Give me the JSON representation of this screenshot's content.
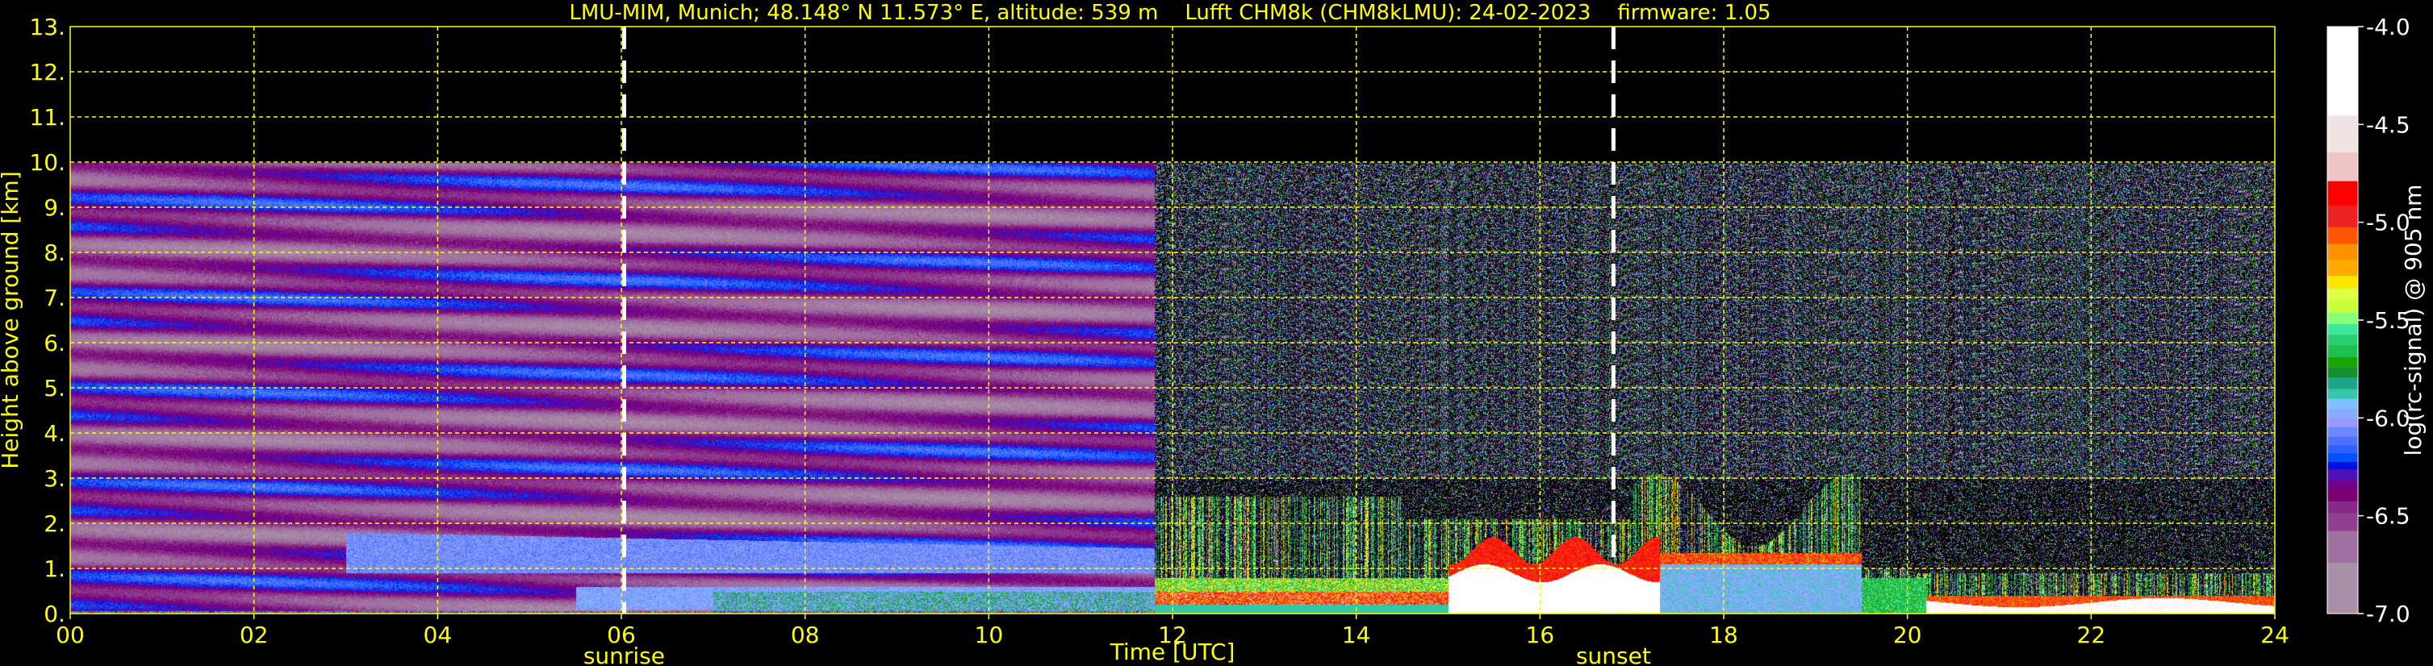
{
  "chart_data": {
    "type": "heatmap",
    "title": "LMU-MIM, Munich; 48.148° N 11.573° E, altitude: 539 m    Lufft CHM8k (CHM8kLMU): 24-02-2023    firmware: 1.05",
    "xlabel": "Time [UTC]",
    "ylabel": "Height above ground [km]",
    "xlim": [
      0,
      24
    ],
    "ylim": [
      0,
      13
    ],
    "grid": true,
    "x_ticks": [
      0,
      2,
      4,
      6,
      8,
      10,
      12,
      14,
      16,
      18,
      20,
      22,
      24
    ],
    "x_tick_labels": [
      "00",
      "02",
      "04",
      "06",
      "08",
      "10",
      "12",
      "14",
      "16",
      "18",
      "20",
      "22",
      "24"
    ],
    "y_ticks": [
      0,
      1,
      2,
      3,
      4,
      5,
      6,
      7,
      8,
      9,
      10,
      11,
      12,
      13
    ],
    "y_tick_labels": [
      "0.",
      "1.",
      "2.",
      "3.",
      "4.",
      "5.",
      "6.",
      "7.",
      "8.",
      "9.",
      "10.",
      "11.",
      "12.",
      "13."
    ],
    "data_max_height_km": 10,
    "annotations": [
      {
        "label": "sunrise",
        "time_utc": 6.03
      },
      {
        "label": "sunset",
        "time_utc": 16.8
      }
    ],
    "colorbar": {
      "label": "log(rc-signal) @ 905 nm",
      "range": [
        -7.0,
        -4.0
      ],
      "ticks": [
        -4.0,
        -4.5,
        -5.0,
        -5.5,
        -6.0,
        -6.5,
        -7.0
      ],
      "tick_labels": [
        "-4.0",
        "-4.5",
        "-5.0",
        "-5.5",
        "-6.0",
        "-6.5",
        "-7.0"
      ],
      "boundaries": [
        -4.0,
        -4.455,
        -4.643,
        -4.79,
        -4.914,
        -5.025,
        -5.111,
        -5.191,
        -5.274,
        -5.339,
        -5.399,
        -5.462,
        -5.521,
        -5.575,
        -5.629,
        -5.69,
        -5.744,
        -5.794,
        -5.852,
        -5.902,
        -5.954,
        -6.004,
        -6.047,
        -6.097,
        -6.14,
        -6.181,
        -6.225,
        -6.264,
        -6.318,
        -6.361,
        -6.426,
        -6.487,
        -6.578,
        -6.74,
        -7.0
      ],
      "colors": [
        "#ffffff",
        "#efe3e3",
        "#efc4c4",
        "#ff0000",
        "#ee2222",
        "#ff5500",
        "#ff9000",
        "#ffaa00",
        "#ffe600",
        "#ddff44",
        "#c8ff3a",
        "#88ff77",
        "#3de89a",
        "#28d070",
        "#20c050",
        "#1aa600",
        "#149030",
        "#20a488",
        "#30c8a8",
        "#80c0ff",
        "#88aaff",
        "#9898ff",
        "#6a88ff",
        "#5070ff",
        "#3060ff",
        "#0050ff",
        "#0010e0",
        "#5010b8",
        "#700090",
        "#780070",
        "#882888",
        "#904090",
        "#a070a0",
        "#a890a8"
      ]
    },
    "colors": {
      "text": "#ffff00",
      "grid": "#ffff00",
      "background": "#000000",
      "sun_lines": "#ffffff",
      "colorbar_text": "#ffffff"
    }
  }
}
